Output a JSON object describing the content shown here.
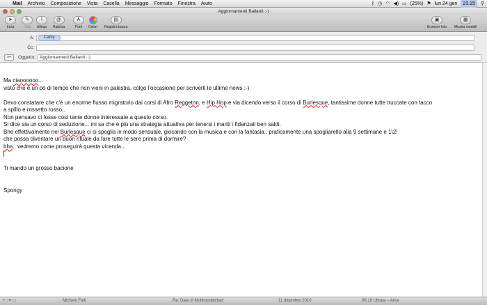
{
  "menubar": {
    "apple": "",
    "items": [
      "Mail",
      "Archivio",
      "Composizione",
      "Vista",
      "Casella",
      "Messaggio",
      "Formato",
      "Finestra",
      "Aiuto"
    ],
    "battery": "(25%)",
    "date": "lun 24 gen",
    "time": "23.15"
  },
  "window": {
    "title": "Aggiornamenti Ballanti :-)"
  },
  "toolbar": {
    "send": "Invia",
    "chat": "Chat",
    "attach": "Allega",
    "addressbook": "Rubrica",
    "font": "Font",
    "colors": "Colori",
    "save_draft": "Registra bozza",
    "photo_browser": "Browser foto",
    "show_templates": "Mostra modelli"
  },
  "header": {
    "to_label": "A:",
    "to_token": "Camy",
    "cc_label": "Cc:",
    "subject_label": "Oggetto:",
    "subject_value": "Aggiornamenti Ballanti :-)"
  },
  "message": {
    "greeting_pre": "Ma ",
    "greeting_word": "ciaoooooo",
    "greeting_post": "...",
    "line2": "visto che è un pò di tempo che non vieni in palestra, colgo l'occasione per scriverti le ultime news :-)",
    "l4_a": "Devo constatare che c'è un enorme flusso migratorio dai corsi di Afro ",
    "l4_reggeton": "Reggeton",
    "l4_b": ", e ",
    "l4_hip": "Hip Hop",
    "l4_c": " e via dicendo verso il corso di ",
    "l4_burlesque": "Burlesque",
    "l4_d": ", tantissime donne tutte truccate con tacco",
    "line5": "a spillo e rossetto rosso..",
    "line6": "Non pensavo ci fosse così tante donne interessate a questo corso.",
    "line7": "Si dice sia un corso di seduzione... mi sa che è più una strategia attuativa per tenersi i mariti \\ fidanzati ben saldi.",
    "l8_a": "Bhe effettivamente nel ",
    "l8_burlesque": "Burlesque",
    "l8_b": " ci si spoglia in modo sensuale, giocando con la musica e con la fantasia.. praticamente una spogliarello alla 9 settimane e 1\\2!",
    "line9": "che possa diventare un buon rituale da fare tutte le sere prima di dormire?",
    "l10_word": "bha",
    "l10_rest": ".. vedremo come proseguirà questa vicenda...",
    "closing": "Ti mando un grosso bacione",
    "signature": "Spongy"
  },
  "background_list": {
    "c1": "Michele Falli",
    "c2": "Re: Date di Multimodelchat!",
    "c3": "11 dicembre 2010",
    "c4": "06:18  Ultrata – Alice"
  }
}
